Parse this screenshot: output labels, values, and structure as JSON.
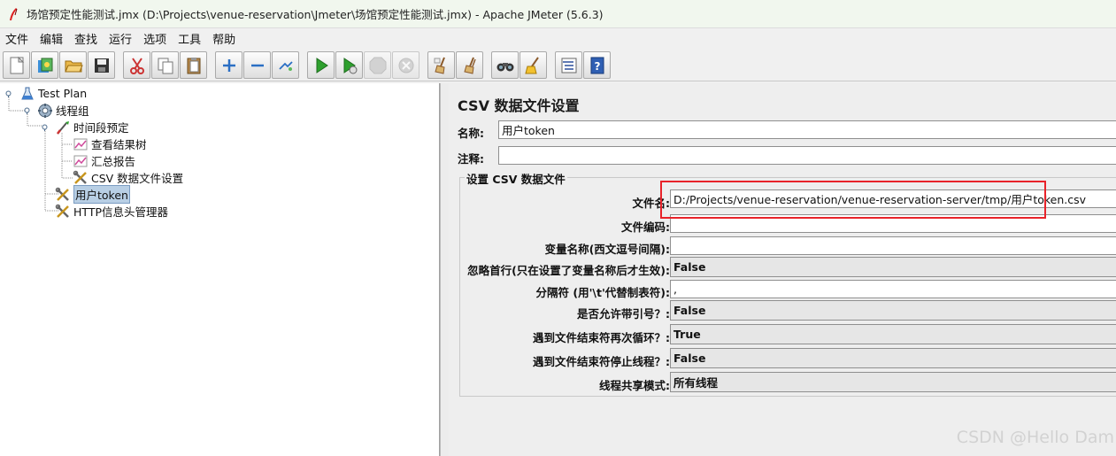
{
  "window": {
    "title": "场馆预定性能测试.jmx (D:\\Projects\\venue-reservation\\Jmeter\\场馆预定性能测试.jmx) - Apache JMeter (5.6.3)"
  },
  "menu": [
    "文件",
    "编辑",
    "查找",
    "运行",
    "选项",
    "工具",
    "帮助"
  ],
  "toolbar": [
    {
      "icon": "new-icon"
    },
    {
      "icon": "templates-icon"
    },
    {
      "icon": "open-icon"
    },
    {
      "icon": "save-icon"
    },
    {
      "icon": "cut-icon"
    },
    {
      "icon": "copy-icon"
    },
    {
      "icon": "paste-icon"
    },
    {
      "icon": "expand-icon"
    },
    {
      "icon": "collapse-icon"
    },
    {
      "icon": "toggle-icon"
    },
    {
      "icon": "start-icon"
    },
    {
      "icon": "start-no-pause-icon"
    },
    {
      "icon": "stop-icon"
    },
    {
      "icon": "shutdown-icon"
    },
    {
      "icon": "clear-icon"
    },
    {
      "icon": "clear-all-icon"
    },
    {
      "icon": "search-icon"
    },
    {
      "icon": "reset-search-icon"
    },
    {
      "icon": "function-helper-icon"
    },
    {
      "icon": "help-icon"
    }
  ],
  "tree": {
    "items": [
      {
        "label": "Test Plan",
        "icon": "test-plan-icon"
      },
      {
        "label": "线程组",
        "icon": "thread-group-icon"
      },
      {
        "label": "时间段预定",
        "icon": "sampler-icon"
      },
      {
        "label": "查看结果树",
        "icon": "listener-icon"
      },
      {
        "label": "汇总报告",
        "icon": "listener-icon"
      },
      {
        "label": "CSV 数据文件设置",
        "icon": "config-icon"
      },
      {
        "label": "用户token",
        "icon": "config-icon"
      },
      {
        "label": "HTTP信息头管理器",
        "icon": "config-icon"
      }
    ]
  },
  "panel": {
    "title": "CSV 数据文件设置",
    "name_label": "名称:",
    "name_value": "用户token",
    "comment_label": "注释:",
    "comment_value": "",
    "group_title": "设置 CSV 数据文件",
    "fields": [
      {
        "label": "文件名:",
        "value": "D:/Projects/venue-reservation/venue-reservation-server/tmp/用户token.csv",
        "kind": "text"
      },
      {
        "label": "文件编码:",
        "value": "",
        "kind": "text"
      },
      {
        "label": "变量名称(西文逗号间隔):",
        "value": "",
        "kind": "text"
      },
      {
        "label": "忽略首行(只在设置了变量名称后才生效):",
        "value": "False",
        "kind": "combo"
      },
      {
        "label": "分隔符 (用'\\t'代替制表符):",
        "value": ",",
        "kind": "text"
      },
      {
        "label": "是否允许带引号？:",
        "value": "False",
        "kind": "combo"
      },
      {
        "label": "遇到文件结束符再次循环？:",
        "value": "True",
        "kind": "combo"
      },
      {
        "label": "遇到文件结束符停止线程？:",
        "value": "False",
        "kind": "combo"
      },
      {
        "label": "线程共享模式:",
        "value": "所有线程",
        "kind": "combo"
      }
    ]
  },
  "watermark": "CSDN @Hello Dam",
  "colors": {
    "selection": "#b8cfe5",
    "annotation_red": "#e8232a",
    "titlebar_bg": "#f1f7ee"
  }
}
